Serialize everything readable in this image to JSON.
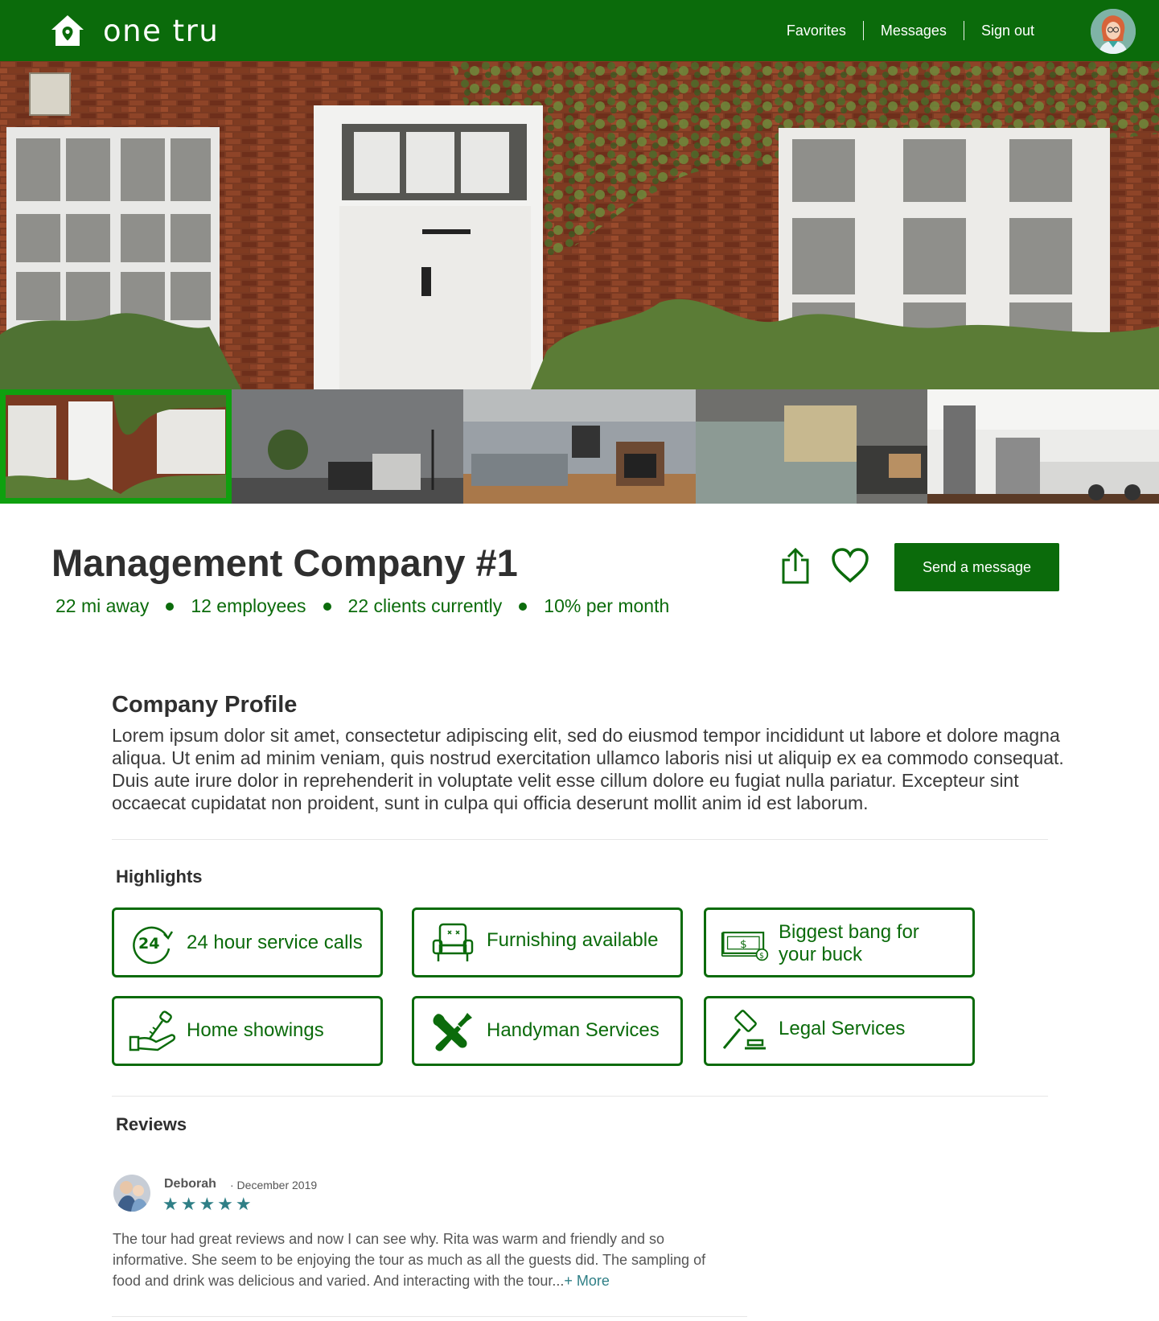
{
  "brand": {
    "name": "one tru"
  },
  "nav": {
    "items": [
      "Favorites",
      "Messages",
      "Sign out"
    ]
  },
  "company": {
    "title": "Management Company #1",
    "stats": [
      "22 mi away",
      "12 employees",
      "22 clients currently",
      "10% per month"
    ],
    "send_label": "Send a message"
  },
  "profile": {
    "heading": "Company Profile",
    "text": "Lorem ipsum dolor sit amet, consectetur adipiscing elit, sed do eiusmod tempor incididunt ut labore et dolore magna aliqua. Ut enim ad minim veniam, quis nostrud exercitation ullamco laboris nisi ut aliquip ex ea commodo consequat. Duis aute irure dolor in reprehenderit in voluptate velit esse cillum dolore eu fugiat nulla pariatur. Excepteur sint occaecat cupidatat non proident, sunt in culpa qui officia deserunt mollit anim id est laborum."
  },
  "highlights": {
    "heading": "Highlights",
    "items": [
      {
        "label": "24 hour service calls",
        "icon": "24-hour-icon"
      },
      {
        "label": "Furnishing available",
        "icon": "armchair-icon"
      },
      {
        "label": "Biggest bang for your buck",
        "icon": "money-icon"
      },
      {
        "label": "Home showings",
        "icon": "hand-key-icon"
      },
      {
        "label": "Handyman Services",
        "icon": "tools-icon"
      },
      {
        "label": "Legal Services",
        "icon": "gavel-icon"
      }
    ]
  },
  "reviews": {
    "heading": "Reviews",
    "items": [
      {
        "name": "Deborah",
        "date": "· December 2019",
        "stars": "★★★★★",
        "rating": 5,
        "text": "The tour had great reviews and now I can see why. Rita was warm and friendly and so informative. She seem to be enjoying the tour as much as all the guests did. The sampling of food and drink was delicious and varied. And interacting with the tour...",
        "more": "+ More"
      }
    ]
  },
  "colors": {
    "brand_green": "#0b6b0b",
    "thumb_selected": "#0fa00f",
    "star_teal": "#2f7f86"
  }
}
